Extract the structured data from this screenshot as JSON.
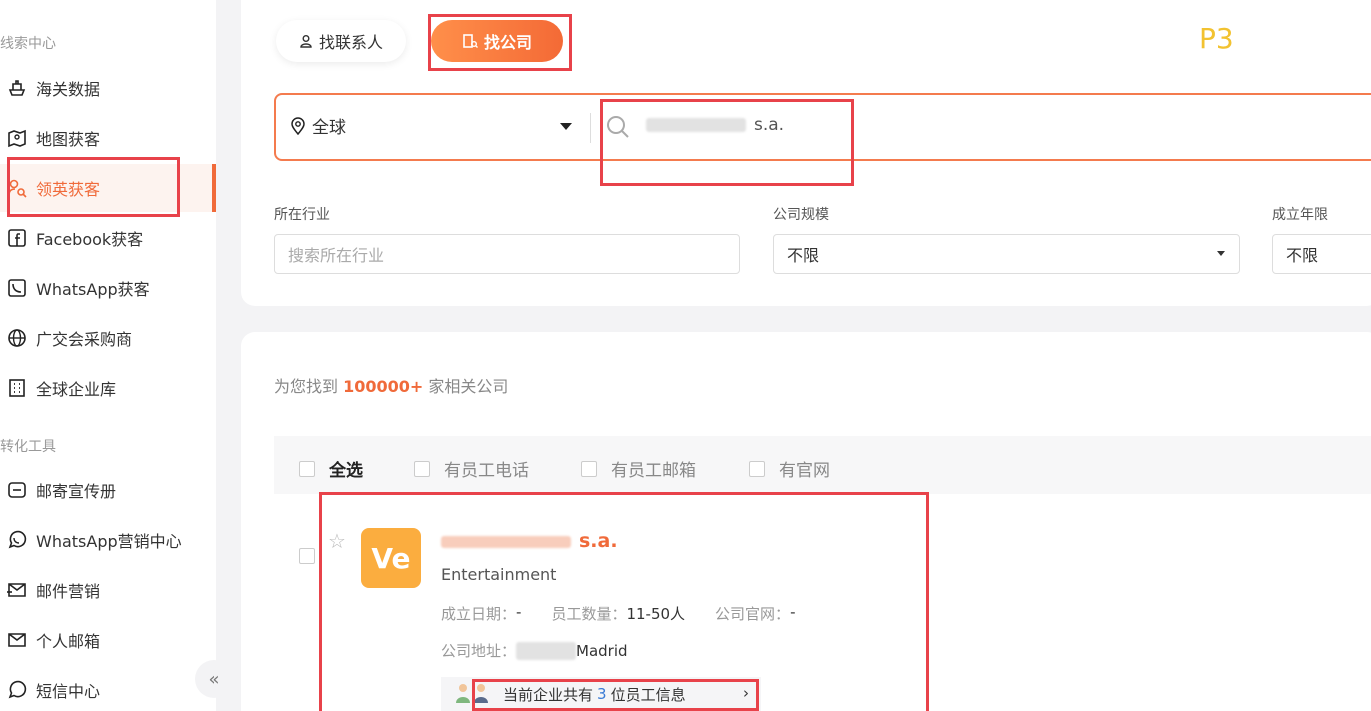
{
  "sidebar": {
    "section1_title": "线索中心",
    "section2_title": "转化工具",
    "items": [
      {
        "label": "海关数据",
        "icon": "ship-icon"
      },
      {
        "label": "地图获客",
        "icon": "map-icon"
      },
      {
        "label": "领英获客",
        "icon": "person-search-icon"
      },
      {
        "label": "Facebook获客",
        "icon": "facebook-icon"
      },
      {
        "label": "WhatsApp获客",
        "icon": "phone-icon"
      },
      {
        "label": "广交会采购商",
        "icon": "globe-icon"
      },
      {
        "label": "全球企业库",
        "icon": "building-icon"
      },
      {
        "label": "邮寄宣传册",
        "icon": "brochure-icon"
      },
      {
        "label": "WhatsApp营销中心",
        "icon": "whatsapp-icon"
      },
      {
        "label": "邮件营销",
        "icon": "mail-send-icon"
      },
      {
        "label": "个人邮箱",
        "icon": "mail-icon"
      },
      {
        "label": "短信中心",
        "icon": "chat-icon"
      }
    ],
    "active_index": 2,
    "collapse_label": "«"
  },
  "tabs": {
    "person": "找联系人",
    "company": "找公司"
  },
  "annotation_label": "P3",
  "search": {
    "region": "全球",
    "value_suffix": "s.a."
  },
  "filters": {
    "industry_label": "所在行业",
    "industry_placeholder": "搜索所在行业",
    "size_label": "公司规模",
    "size_value": "不限",
    "years_label": "成立年限",
    "years_value": "不限"
  },
  "results": {
    "prefix": "为您找到",
    "count": "100000+",
    "suffix": "家相关公司",
    "select_all": "全选",
    "opt_phone": "有员工电话",
    "opt_email": "有员工邮箱",
    "opt_site": "有官网"
  },
  "company": {
    "logo_text": "Ve",
    "name_suffix": "s.a.",
    "industry": "Entertainment",
    "founded_label": "成立日期：",
    "founded_value": "-",
    "employees_label": "员工数量：",
    "employees_value": "11-50人",
    "website_label": "公司官网：",
    "website_value": "-",
    "address_label": "公司地址：",
    "address_value": "Madrid",
    "emp_info_prefix": "当前企业共有",
    "emp_info_count": "3",
    "emp_info_suffix": "位员工信息"
  },
  "colors": {
    "accent": "#f06a3a",
    "annotation": "#e8424a",
    "logo_bg": "#fbad3f",
    "p3": "#f2c230"
  }
}
